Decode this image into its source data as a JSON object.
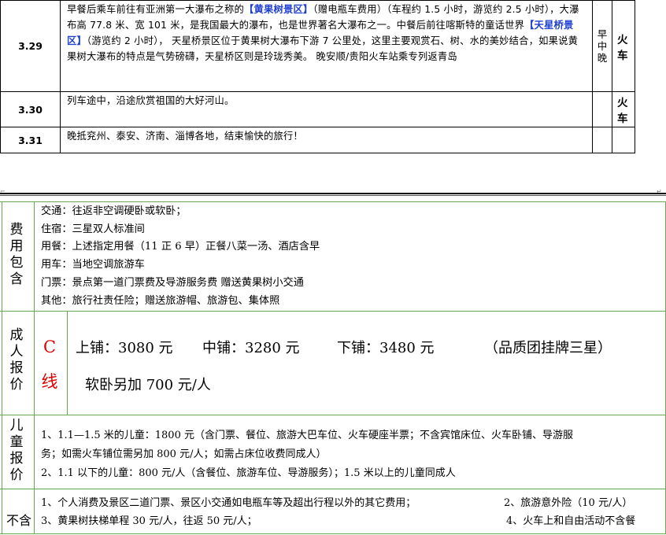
{
  "itinerary": [
    {
      "date": "3.29",
      "segments": [
        {
          "t": "早餐后乘车前往有亚洲第一大瀑布之称的"
        },
        {
          "t": "【黄果树景区】",
          "hl": true
        },
        {
          "t": "（赠电瓶车费用）（车程约 1.5 小时，游览约 2.5 小时），大瀑布高 77.8 米、宽 101 米，是我国最大的瀑布，也是世界著名大瀑布之一。中餐后前往喀斯特的童话世界"
        },
        {
          "t": "【天星桥景区】",
          "hl": true
        },
        {
          "t": "（游览约 2 小时），  天星桥景区位于黄果树大瀑布下游 7 公里处，这里主要观赏石、树、水的美妙结合，如果说黄果树大瀑布的特点是气势磅礴，天星桥区则是玲珑秀美。  晚安顺/贵阳火车站乘专列返青岛"
        }
      ],
      "meals": "早\n中\n晚",
      "transport": "火车"
    },
    {
      "date": "3.30",
      "segments": [
        {
          "t": "列车途中，沿途欣赏祖国的大好河山。"
        }
      ],
      "meals": "",
      "transport": "火车"
    },
    {
      "date": "3.31",
      "segments": [
        {
          "t": "晚抵兖州、泰安、济南、淄博各地，结束愉快的旅行！"
        }
      ],
      "meals": "",
      "transport": ""
    }
  ],
  "fees_included": {
    "label": [
      "费",
      "用",
      "包",
      "含"
    ],
    "lines": [
      "交通：往返非空调硬卧或软卧；",
      "住宿：三星双人标准间",
      "用餐：上述指定用餐（11 正 6 早）正餐八菜一汤、酒店含早",
      "用车：当地空调旅游车",
      "门票：景点第一道门票费及导游服务费 赠送黄果树小交通",
      "其他：旅行社责任险；赠送旅游帽、旅游包、集体照"
    ]
  },
  "adult_price": {
    "label": [
      "成",
      "人",
      "报",
      "价"
    ],
    "line_label": [
      "C",
      "线"
    ],
    "upper": "上铺：3080 元",
    "middle": "中铺：3280 元",
    "lower": "下铺：3480 元",
    "note": "（品质团挂牌三星）",
    "soft": "软卧另加 700 元/人"
  },
  "child_price": {
    "label": [
      "儿",
      "童",
      "报",
      "价"
    ],
    "lines": [
      "1、1.1—1.5 米的儿童：1800 元（含门票、餐位、旅游大巴车位、火车硬座半票；不含宾馆床位、火车卧铺、导游服",
      "   务；如需火车铺位需另加 800 元/人；如需占床位收费同成人）",
      "2、1.1 以下的儿童：800 元/人（含餐位、旅游车位、导游服务）；1.5 米以上的儿童同成人"
    ]
  },
  "excluded": {
    "label": "不含",
    "item1": "1、个人消费及景区二道门票、景区小交通如电瓶车等及超出行程以外的其它费用；",
    "item2": "2、旅游意外险（10 元/人）",
    "item3": "3、黄果树扶梯单程 30 元/人，往返 50 元/人；",
    "item4": "4、火车上和自由活动不含餐"
  }
}
